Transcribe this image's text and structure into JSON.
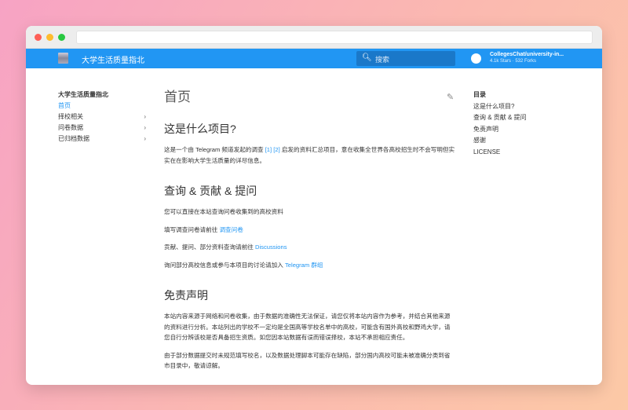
{
  "colors": {
    "primary": "#2196f3",
    "link": "#2196f3"
  },
  "header": {
    "title": "大学生活质量指北",
    "search_placeholder": "搜索",
    "repo_name": "CollegesChat/university-in...",
    "repo_stats": "4.1k Stars · 532 Forks"
  },
  "nav": {
    "title": "大学生活质量指北",
    "items": [
      {
        "label": "首页",
        "active": true
      },
      {
        "label": "择校相关",
        "chevron": true
      },
      {
        "label": "问卷数据",
        "chevron": true
      },
      {
        "label": "已归档数据",
        "chevron": true
      }
    ]
  },
  "toc": {
    "title": "目录",
    "items": [
      "这是什么项目?",
      "查询 & 贡献 & 提问",
      "免责声明",
      "感谢",
      "LICENSE"
    ]
  },
  "main": {
    "title": "首页",
    "s1": {
      "heading": "这是什么项目?",
      "p1_a": "这是一个由 Telegram 频道发起的调查 ",
      "link1": "[1]",
      "link2": "[2]",
      "p1_b": " 启发的资料汇总项目，意在收集全世界各高校招生时不会写明但实实在在影响大学生活质量的详尽信息。"
    },
    "s2": {
      "heading": "查询 & 贡献 & 提问",
      "p1": "您可以直接在本站查询问卷收集到的高校资料",
      "p2": "填写调查问卷请前往 ",
      "p2_link": "调查问卷",
      "p3": "贡献、提问、部分资料查询请前往 ",
      "p3_link": "Discussions",
      "p4": "询问部分高校信息或参与本项目的讨论请加入 ",
      "p4_link": "Telegram 群组"
    },
    "s3": {
      "heading": "免责声明",
      "p1": "本站内容来源于网络和问卷收集，由于数据的准确性无法保证，请您仅将本站内容作为参考，并结合其他来源的资料进行分析。本站列出的学校不一定均是全国高等学校名单中的高校，可能含有国外高校和野鸡大学，请您自行分辨该校是否具备招生资质。如您因本站数据有误而错误择校，本站不承担相应责任。",
      "p2": "由于部分数据提交时未规范填写校名，以及数据处理脚本可能存在缺陷，部分国内高校可能未被准确分类到省市目录中，敬请谅解。"
    }
  }
}
